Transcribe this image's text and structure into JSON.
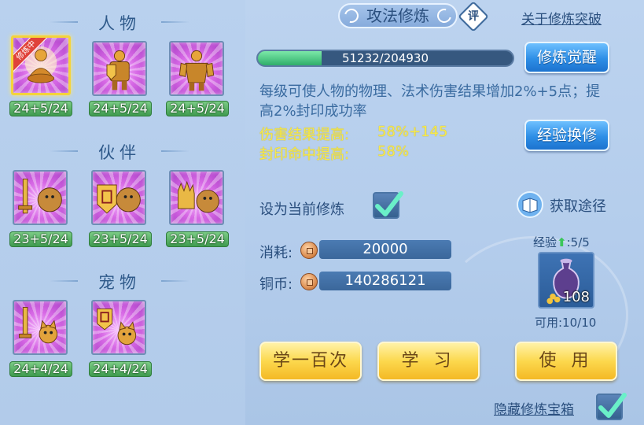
{
  "left": {
    "sections": [
      {
        "title": "人物",
        "slots": [
          {
            "level": "24+5/24",
            "selected": true,
            "ribbon": "修炼中",
            "icon": "meditating-warrior-icon"
          },
          {
            "level": "24+5/24",
            "icon": "armored-warrior-shield-icon"
          },
          {
            "level": "24+5/24",
            "icon": "golden-warrior-icon"
          }
        ]
      },
      {
        "title": "伙伴",
        "slots": [
          {
            "level": "23+5/24",
            "icon": "lion-sword-icon"
          },
          {
            "level": "23+5/24",
            "icon": "lion-shield-icon"
          },
          {
            "level": "23+5/24",
            "icon": "lion-glove-icon"
          }
        ]
      },
      {
        "title": "宠物",
        "slots": [
          {
            "level": "24+4/24",
            "icon": "cat-sword-icon"
          },
          {
            "level": "24+4/24",
            "icon": "cat-shield-icon"
          }
        ]
      }
    ]
  },
  "header": {
    "title": "攻法修炼",
    "rate_badge": "评",
    "breakthrough_link": "关于修炼突破"
  },
  "progress": {
    "text": "51232/204930",
    "current": 51232,
    "max": 204930,
    "fraction": 0.25
  },
  "buttons": {
    "awaken": "修炼觉醒",
    "exchange": "经验换修",
    "learn100": "学一百次",
    "learn": "学 习",
    "use": "使 用"
  },
  "description": "每级可使人物的物理、法术伤害结果增加2%+5点；提高2%封印成功率",
  "stats": [
    {
      "label": "伤害结果提高:",
      "value": "58%+145"
    },
    {
      "label": "封印命中提高:",
      "value": "58%"
    }
  ],
  "set_current": {
    "label": "设为当前修炼",
    "checked": true
  },
  "source_link": "获取途径",
  "cost": {
    "label": "消耗:",
    "value": "20000"
  },
  "copper": {
    "label": "铜币:",
    "value": "140286121"
  },
  "experience": {
    "label": "经验",
    "value": ":5/5",
    "available": "可用:10/10",
    "item_count": "108",
    "item_icon": "potion-vase-icon"
  },
  "hide_treasure": {
    "label": "隐藏修炼宝箱",
    "checked": true
  },
  "colors": {
    "accent_blue": "#2d8ee6",
    "gold": "#fcd84d",
    "stat_yellow": "#f6e94c",
    "progress_green": "#2fae6a"
  }
}
